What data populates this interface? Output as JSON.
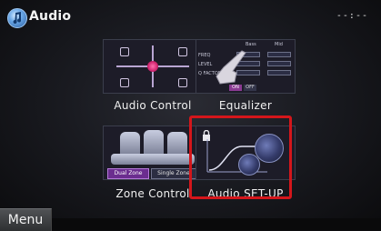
{
  "header": {
    "title": "Audio",
    "clock": "--:--"
  },
  "tiles": {
    "audio_control": {
      "label": "Audio Control"
    },
    "equalizer": {
      "label": "Equalizer",
      "columns": [
        "Bass",
        "Mid"
      ],
      "rows": [
        "FREQ",
        "LEVEL",
        "Q FACTOR"
      ],
      "on_label": "ON",
      "off_label": "OFF"
    },
    "zone_control": {
      "label": "Zone Control",
      "dual_zone_label": "Dual Zone",
      "single_zone_label": "Single Zone"
    },
    "audio_setup": {
      "label": "Audio SET-UP",
      "selected": true
    }
  },
  "footer": {
    "menu_label": "Menu"
  },
  "colors": {
    "selection_frame": "#d4161b",
    "accent_purple": "#6b2d8f"
  },
  "icons": {
    "app": "music-note-icon",
    "lock": "lock-icon"
  }
}
